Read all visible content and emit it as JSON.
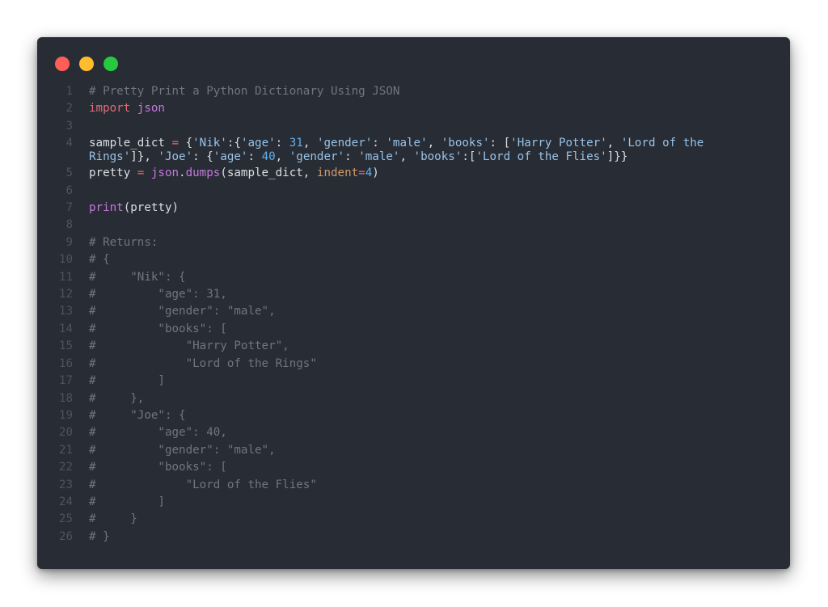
{
  "window": {
    "controls": [
      "close",
      "minimize",
      "maximize"
    ],
    "colors": {
      "close": "#ff5f56",
      "minimize": "#ffbd2e",
      "maximize": "#27c93f",
      "background": "#282c34"
    }
  },
  "code": {
    "language": "python",
    "lines": [
      {
        "n": "1",
        "text": "# Pretty Print a Python Dictionary Using JSON"
      },
      {
        "n": "2",
        "kw": "import",
        "mod": "json"
      },
      {
        "n": "3",
        "text": ""
      },
      {
        "n": "4",
        "l4a": "sample_dict",
        "l4b": " = ",
        "l4c": "{",
        "l4d": "'Nik'",
        "l4e": ":{",
        "l4f": "'age'",
        "l4g": ": ",
        "l4h": "31",
        "l4i": ", ",
        "l4j": "'gender'",
        "l4k": ": ",
        "l4l": "'male'",
        "l4m": ", ",
        "l4n": "'books'",
        "l4o": ": [",
        "l4p": "'Harry Potter'",
        "l4q": ", ",
        "l4r": "'Lord of the Rings'",
        "l4s": "]}, ",
        "l4t": "'Joe'",
        "l4u": ": {",
        "l4v": "'age'",
        "l4w": ": ",
        "l4x": "40",
        "l4y": ", ",
        "l4z": "'gender'",
        "l4aa": ": ",
        "l4ab": "'male'",
        "l4ac": ", ",
        "l4ad": "'books'",
        "l4ae": ":[",
        "l4af": "'Lord of the Flies'",
        "l4ag": "]}}"
      },
      {
        "n": "5",
        "a": "pretty",
        "b": " = ",
        "c": "json",
        "d": ".",
        "e": "dumps",
        "f": "(sample_dict, ",
        "g": "indent",
        "h": "=",
        "i": "4",
        "j": ")"
      },
      {
        "n": "6",
        "text": ""
      },
      {
        "n": "7",
        "fn": "print",
        "rest": "(pretty)"
      },
      {
        "n": "8",
        "text": ""
      },
      {
        "n": "9",
        "text": "# Returns:"
      },
      {
        "n": "10",
        "text": "# {"
      },
      {
        "n": "11",
        "text": "#     \"Nik\": {"
      },
      {
        "n": "12",
        "text": "#         \"age\": 31,"
      },
      {
        "n": "13",
        "text": "#         \"gender\": \"male\","
      },
      {
        "n": "14",
        "text": "#         \"books\": ["
      },
      {
        "n": "15",
        "text": "#             \"Harry Potter\","
      },
      {
        "n": "16",
        "text": "#             \"Lord of the Rings\""
      },
      {
        "n": "17",
        "text": "#         ]"
      },
      {
        "n": "18",
        "text": "#     },"
      },
      {
        "n": "19",
        "text": "#     \"Joe\": {"
      },
      {
        "n": "20",
        "text": "#         \"age\": 40,"
      },
      {
        "n": "21",
        "text": "#         \"gender\": \"male\","
      },
      {
        "n": "22",
        "text": "#         \"books\": ["
      },
      {
        "n": "23",
        "text": "#             \"Lord of the Flies\""
      },
      {
        "n": "24",
        "text": "#         ]"
      },
      {
        "n": "25",
        "text": "#     }"
      },
      {
        "n": "26",
        "text": "# }"
      }
    ]
  }
}
